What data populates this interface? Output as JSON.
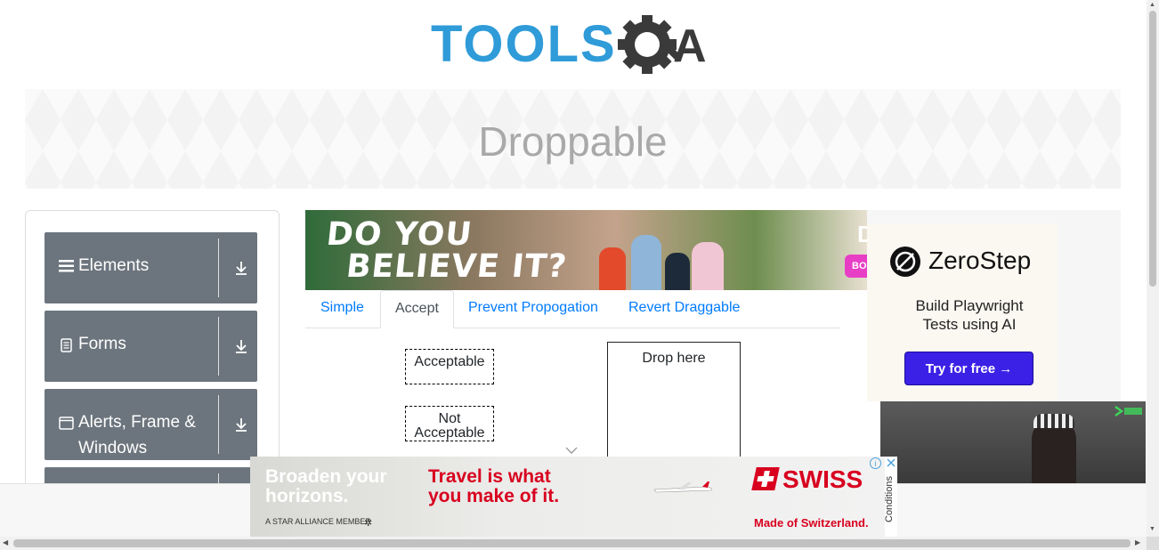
{
  "brand": {
    "logo_text_left": "TOOLS",
    "logo_text_right": "A",
    "color_blue": "#2f9bd8",
    "color_dark": "#3a3a3a"
  },
  "banner": {
    "title": "Droppable"
  },
  "sidebar": {
    "groups": [
      {
        "label": "Elements",
        "icon": "menu-lines-icon"
      },
      {
        "label": "Forms",
        "icon": "document-icon"
      },
      {
        "label_line1": "Alerts, Frame &",
        "label_line2": "Windows",
        "icon": "window-icon"
      }
    ],
    "group_color": "#6c757d"
  },
  "ad_top": {
    "headline_line1": "DO YOU",
    "headline_line2": "BELIEVE IT?",
    "fragment": "D",
    "button_fragment": "BO"
  },
  "tabs": [
    {
      "label": "Simple",
      "active": false
    },
    {
      "label": "Accept",
      "active": true
    },
    {
      "label": "Prevent Propogation",
      "active": false
    },
    {
      "label": "Revert Draggable",
      "active": false
    }
  ],
  "accept_panel": {
    "acceptable": "Acceptable",
    "not_acceptable_line1": "Not",
    "not_acceptable_line2": "Acceptable",
    "drop_target": "Drop here"
  },
  "ad_right": {
    "brand": "ZeroStep",
    "subtitle_line1": "Build Playwright",
    "subtitle_line2": "Tests using AI",
    "button": "Try for free →",
    "button_color": "#3b20e6"
  },
  "ad_bottom": {
    "left_line1": "Broaden your",
    "left_line2": "horizons.",
    "member": "A STAR ALLIANCE MEMBER",
    "mid_line1": "Travel is what",
    "mid_line2": "you make of it.",
    "brand": "SWISS",
    "brand_tagline": "Made of Switzerland.",
    "conditions": "Conditions",
    "accent": "#d8001e"
  }
}
